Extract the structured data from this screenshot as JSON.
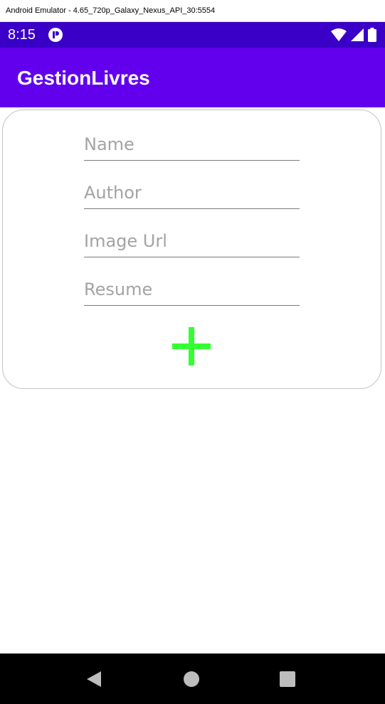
{
  "window": {
    "title": "Android Emulator - 4.65_720p_Galaxy_Nexus_API_30:5554"
  },
  "status_bar": {
    "time": "8:15",
    "icons": [
      "notification-icon",
      "wifi-icon",
      "signal-icon",
      "battery-icon"
    ],
    "background": "#3a00c8"
  },
  "app_bar": {
    "title": "GestionLivres",
    "background": "#6200ee"
  },
  "form": {
    "fields": [
      {
        "placeholder": "Name",
        "value": ""
      },
      {
        "placeholder": "Author",
        "value": ""
      },
      {
        "placeholder": "Image Url",
        "value": ""
      },
      {
        "placeholder": "Resume",
        "value": ""
      }
    ],
    "add_button": {
      "icon": "plus-icon",
      "color": "#33ff33"
    }
  },
  "nav_bar": {
    "buttons": [
      "back-icon",
      "home-icon",
      "recents-icon"
    ]
  }
}
